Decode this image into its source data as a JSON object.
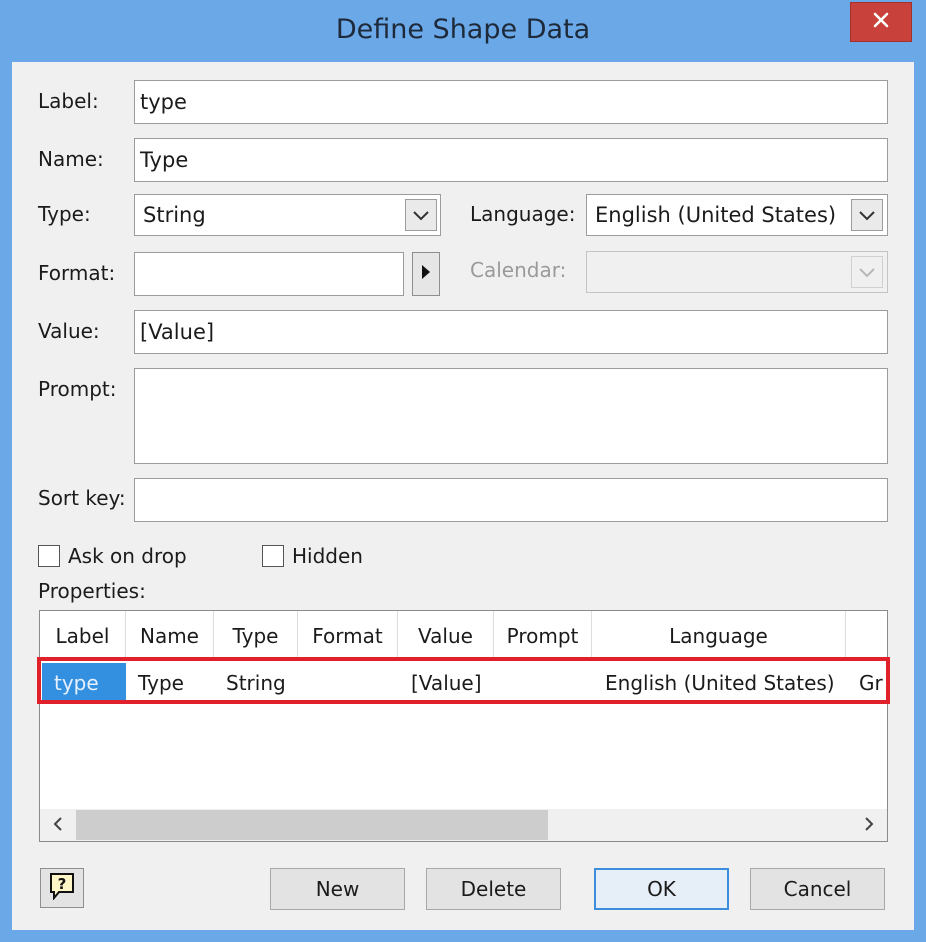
{
  "window": {
    "title": "Define Shape Data",
    "close_glyph": "✕"
  },
  "labels": {
    "label": "Label:",
    "name": "Name:",
    "type": "Type:",
    "language": "Language:",
    "format": "Format:",
    "calendar": "Calendar:",
    "value": "Value:",
    "prompt": "Prompt:",
    "sort_key": "Sort key:",
    "properties": "Properties:"
  },
  "fields": {
    "label": "type",
    "name": "Type",
    "type": "String",
    "language": "English (United States)",
    "format": "",
    "calendar": "",
    "value": "[Value]",
    "prompt": "",
    "sort_key": ""
  },
  "checkboxes": {
    "ask_on_drop": {
      "label": "Ask on drop",
      "checked": false
    },
    "hidden": {
      "label": "Hidden",
      "checked": false
    }
  },
  "grid": {
    "columns": [
      "Label",
      "Name",
      "Type",
      "Format",
      "Value",
      "Prompt",
      "Language",
      ""
    ],
    "rows": [
      {
        "label": "type",
        "name": "Type",
        "type": "String",
        "format": "",
        "value": "[Value]",
        "prompt": "",
        "language": "English (United States)",
        "extra": "Gr"
      }
    ]
  },
  "buttons": {
    "new": "New",
    "delete": "Delete",
    "ok": "OK",
    "cancel": "Cancel"
  },
  "colors": {
    "title_bar": "#6aa8e8",
    "close_button": "#c9413b",
    "selection": "#3390e0",
    "highlight_outline": "#e0202a"
  },
  "icons": {
    "close": "close-icon",
    "dropdown": "chevron-down-icon",
    "format_picker": "triangle-right-icon",
    "help": "help-icon",
    "scroll_left": "chevron-left-icon",
    "scroll_right": "chevron-right-icon"
  }
}
